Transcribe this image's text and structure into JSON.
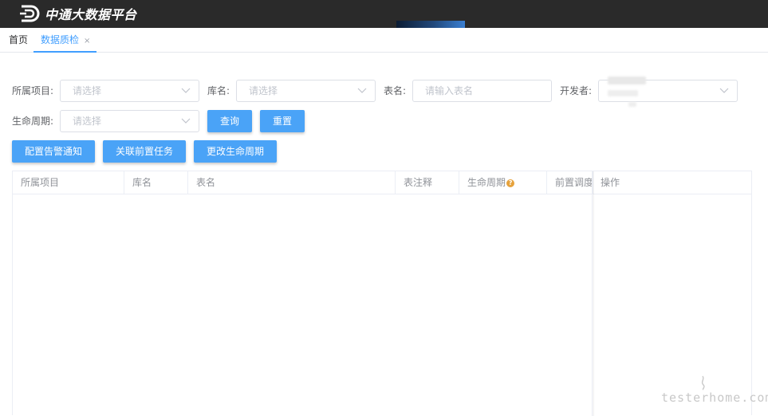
{
  "app": {
    "title": "中通大数据平台"
  },
  "tabs": [
    {
      "label": "首页"
    },
    {
      "label": "数据质检",
      "close": "×"
    }
  ],
  "filters": {
    "project": {
      "label": "所属项目:",
      "placeholder": "请选择"
    },
    "database": {
      "label": "库名:",
      "placeholder": "请选择"
    },
    "table_name": {
      "label": "表名:",
      "placeholder": "请输入表名"
    },
    "developer": {
      "label": "开发者:"
    },
    "lifecycle": {
      "label": "生命周期:",
      "placeholder": "请选择"
    }
  },
  "buttons": {
    "query": "查询",
    "reset": "重置",
    "config_alert": "配置告警通知",
    "link_pre_task": "关联前置任务",
    "change_lifecycle": "更改生命周期"
  },
  "table": {
    "columns": [
      "所属项目",
      "库名",
      "表名",
      "表注释",
      "生命周期",
      "前置调度",
      "操作"
    ],
    "help_icon": "?"
  },
  "watermark": "testerhome.com",
  "colors": {
    "primary": "#409eff",
    "button": "#4aa3f7",
    "topbar": "#2a2a2a",
    "help": "#e6a23c"
  }
}
